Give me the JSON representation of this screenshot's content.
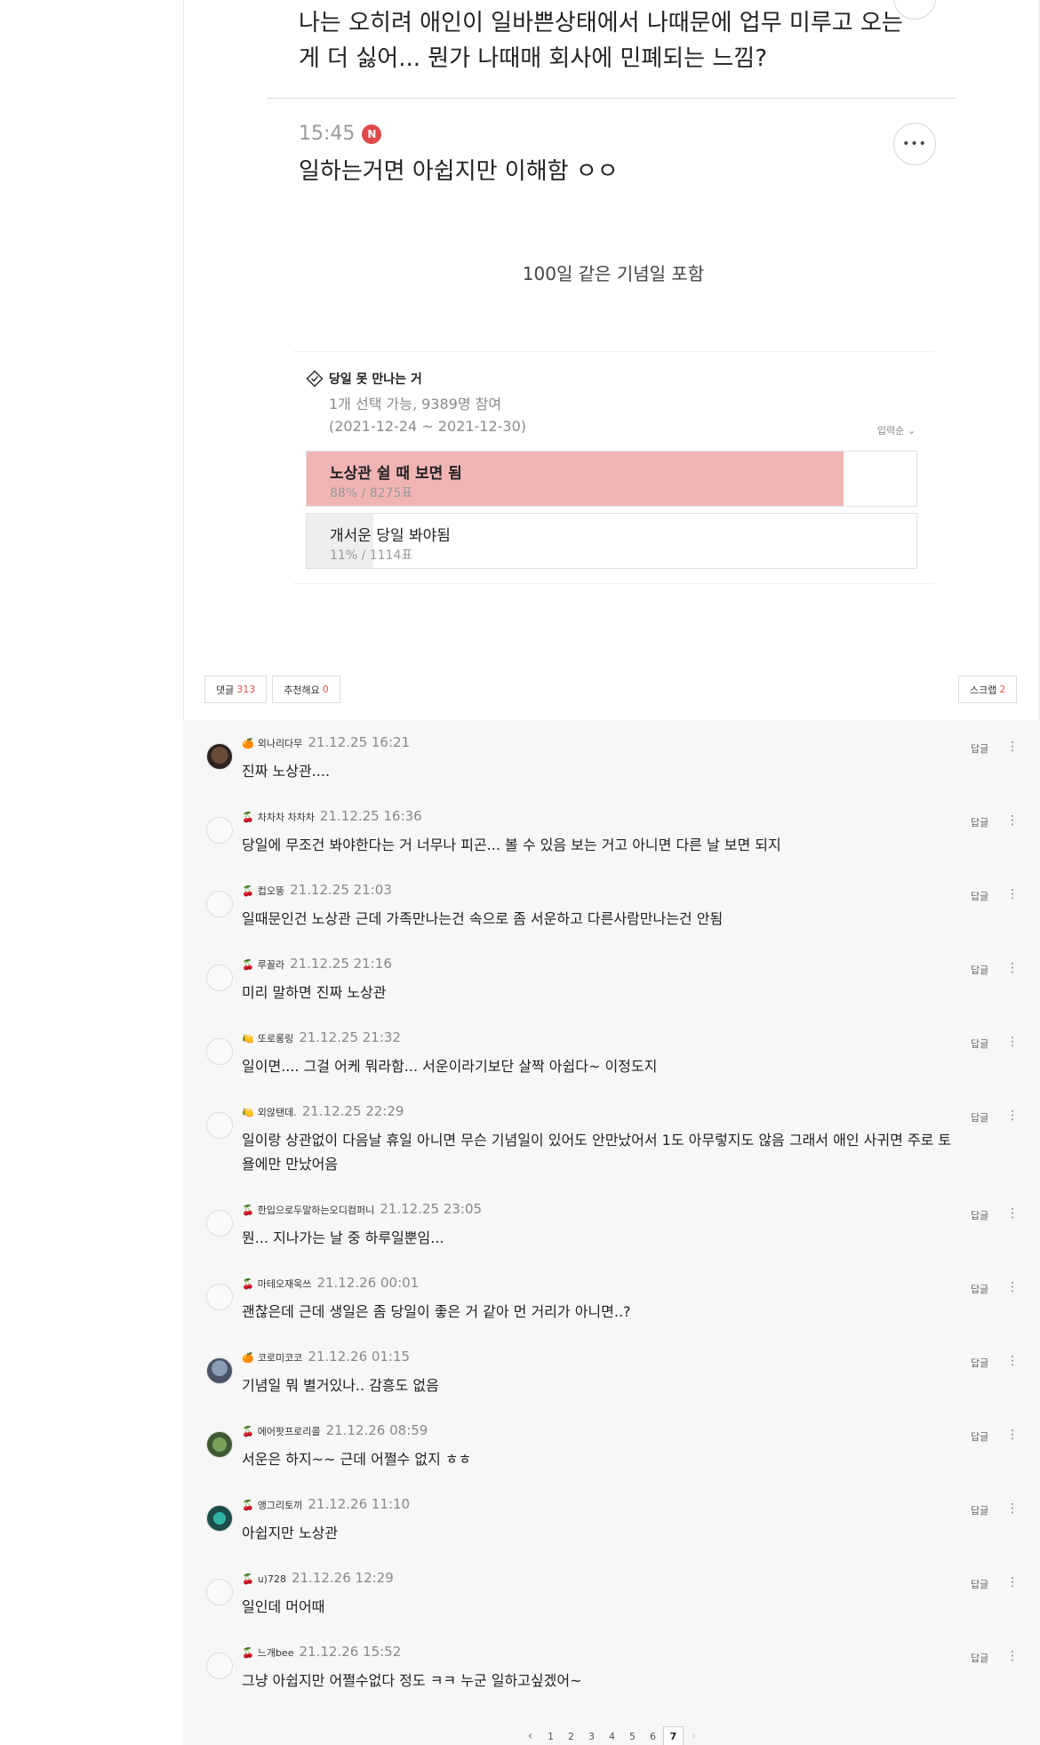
{
  "post": {
    "reply_top_text": "나는 오히려 애인이 일바쁜상태에서 나때문에 업무 미루고 오는게 더 싫어... 뭔가 나때매 회사에 민폐되는 느낌?",
    "reply2_time": "15:45",
    "reply2_badge": "N",
    "reply2_text": "일하는거면 아쉽지만 이해함 ㅇㅇ",
    "body_text": "100일 같은 기념일 포함"
  },
  "poll": {
    "title": "당일 못 만나는 거",
    "meta_line1": "1개 선택 가능, 9389명 참여",
    "meta_line2": "(2021-12-24 ~ 2021-12-30)",
    "sort_label": "입력순 ⌄",
    "options": [
      {
        "label": "노상관 쉴 때 보면 됨",
        "stat": "88% / 8275표",
        "percent": 88,
        "color": "#f1b4b4",
        "bold": true
      },
      {
        "label": "개서운 당일 봐야됨",
        "stat": "11% / 1114표",
        "percent": 11,
        "color": "#eeeeee",
        "bold": false
      }
    ]
  },
  "actions": {
    "comment_label": "댓글",
    "comment_count": "313",
    "recommend_label": "추천해요",
    "recommend_count": "0",
    "scrap_label": "스크랩",
    "scrap_count": "2"
  },
  "comments": [
    {
      "level": "🍊",
      "nick": "외나리다무",
      "date": "21.12.25 16:21",
      "text": "진짜 노상관....",
      "avatar": "photo1"
    },
    {
      "level": "🍒",
      "nick": "차차차 차차차",
      "date": "21.12.25 16:36",
      "text": "당일에 무조건 봐야한다는 거 너무나 피곤... 볼 수 있음 보는 거고 아니면 다른 날 보면 되지",
      "avatar": "sketch"
    },
    {
      "level": "🍒",
      "nick": "컵오뚱",
      "date": "21.12.25 21:03",
      "text": "일때문인건 노상관 근데 가족만나는건 속으로 좀 서운하고 다른사람만나는건 안됨",
      "avatar": "sketch"
    },
    {
      "level": "🍒",
      "nick": "루꼴라",
      "date": "21.12.25 21:16",
      "text": "미리 말하면 진짜 노상관",
      "avatar": "sketch"
    },
    {
      "level": "🍋",
      "nick": "또로롱링",
      "date": "21.12.25 21:32",
      "text": "일이면.... 그걸 어케 뭐라함... 서운이라기보단 살짝 아쉽다~ 이정도지",
      "avatar": "sketch"
    },
    {
      "level": "🍋",
      "nick": "외않탠데.",
      "date": "21.12.25 22:29",
      "text": "일이랑 상관없이 다음날 휴일 아니면 무슨 기념일이 있어도 안만났어서 1도 아무렇지도 않음 그래서 애인 사귀면 주로 토욜에만 만났어음",
      "avatar": "sketch"
    },
    {
      "level": "🍒",
      "nick": "한입으로두말하는오디컴퍼니",
      "date": "21.12.25 23:05",
      "text": "뭔... 지나가는 날 중 하루일뿐임...",
      "avatar": "sketch"
    },
    {
      "level": "🍒",
      "nick": "마테오재욱쓰",
      "date": "21.12.26 00:01",
      "text": "괜찮은데 근데 생일은 좀 당일이 좋은 거 같아 먼 거리가 아니면..?",
      "avatar": "sketch"
    },
    {
      "level": "🍊",
      "nick": "코로미코코",
      "date": "21.12.26 01:15",
      "text": "기념일 뭐 별거있나.. 감흥도 없음",
      "avatar": "photo2"
    },
    {
      "level": "🍒",
      "nick": "에어팟프로리콜",
      "date": "21.12.26 08:59",
      "text": "서운은 하지~~ 근데 어쩔수 없지 ㅎㅎ",
      "avatar": "photo3"
    },
    {
      "level": "🍒",
      "nick": "앵그리토끼",
      "date": "21.12.26 11:10",
      "text": "아쉽지만 노상관",
      "avatar": "photo4"
    },
    {
      "level": "🍒",
      "nick": "u)728",
      "date": "21.12.26 12:29",
      "text": "일인데 머어때",
      "avatar": "sketch"
    },
    {
      "level": "🍒",
      "nick": "느개bee",
      "date": "21.12.26 15:52",
      "text": "그냥 아쉽지만 어쩔수없다 정도 ㅋㅋ 누군 일하고싶겠어~",
      "avatar": "sketch"
    }
  ],
  "comment_ui": {
    "reply_label": "답글",
    "menu_glyph": "⋮"
  },
  "pagination": {
    "prev": "‹",
    "pages": [
      "1",
      "2",
      "3",
      "4",
      "5",
      "6",
      "7"
    ],
    "current": "7",
    "next": "›"
  }
}
